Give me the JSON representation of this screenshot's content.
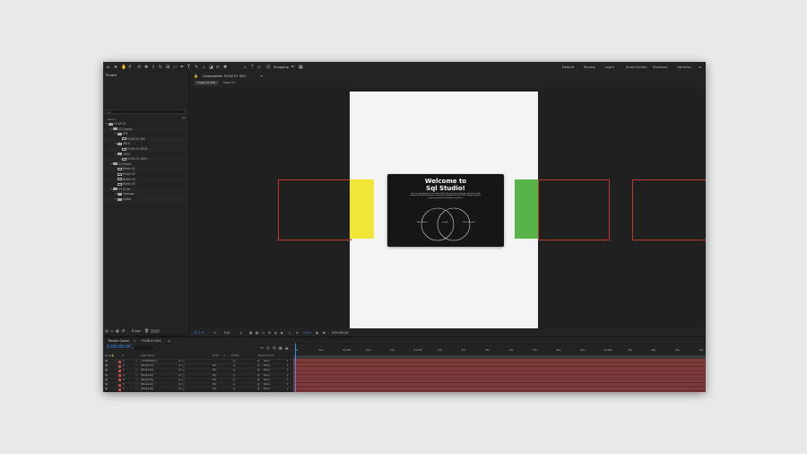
{
  "toolbar": {
    "snapping_label": "Snapping",
    "workspaces": [
      "Default",
      "Review",
      "Learn",
      "Small Screen",
      "Standard",
      "Libraries",
      "≫"
    ]
  },
  "project": {
    "tab_label": "Project",
    "search_placeholder": "ρ▾",
    "column_name": "Name",
    "tree": [
      {
        "label": "FLOW 01",
        "type": "folder",
        "indent": 0
      },
      {
        "label": "01.Comps",
        "type": "folder",
        "indent": 1
      },
      {
        "label": "495",
        "type": "folder",
        "indent": 2
      },
      {
        "label": "FLOW 01 495",
        "type": "comp",
        "indent": 3
      },
      {
        "label": "9816",
        "type": "folder",
        "indent": 2
      },
      {
        "label": "FLOW 01 9816",
        "type": "comp",
        "indent": 3
      },
      {
        "label": "1609",
        "type": "folder",
        "indent": 2
      },
      {
        "label": "FLOW 01 1609",
        "type": "comp",
        "indent": 3
      },
      {
        "label": "02.Media",
        "type": "folder",
        "indent": 1
      },
      {
        "label": "Media 01",
        "type": "comp",
        "indent": 2
      },
      {
        "label": "Media 02",
        "type": "comp",
        "indent": 2
      },
      {
        "label": "Media 03",
        "type": "comp",
        "indent": 2
      },
      {
        "label": "Media 04",
        "type": "comp",
        "indent": 2
      },
      {
        "label": "03.Other",
        "type": "folder",
        "indent": 1
      },
      {
        "label": "Footage",
        "type": "folder",
        "indent": 2
      },
      {
        "label": "Solids",
        "type": "folder",
        "indent": 2
      }
    ],
    "footer_bpc": "8 bpc"
  },
  "viewer": {
    "panel_tab": "Composition FLOW 01 9X5",
    "sub_tabs": [
      "FLOW 01 9X5",
      "Media 01"
    ],
    "card_title_line1": "Welcome to",
    "card_title_line2": "Sql Studio!",
    "card_body": "Our core specialization is the modern SQL structured query language and how it works alongside relational databases, from data modelling and optimisation through analytics, reporting and practical hands-on solutions.",
    "venn_left": "Web Master",
    "venn_center": "Insight",
    "venn_right": "Data Scientist",
    "colors": {
      "yellow": "#f2e737",
      "green": "#58b448",
      "card": "#161616",
      "artboard": "#f4f4f4",
      "outline": "#c0392b"
    },
    "footer": {
      "zoom": "12.5 %",
      "resolution": "Full",
      "exposure": "+0.0",
      "timecode": "0:00:00:00"
    }
  },
  "timeline": {
    "tabs": [
      "Render Queue",
      "FLOW 01 9X5"
    ],
    "timecode": "0:00:00:00",
    "search_placeholder": "ρ▾",
    "columns": [
      "#",
      "Layer Name",
      "Mode",
      "T",
      "TrkMat",
      "Parent & Link"
    ],
    "layers": [
      {
        "num": "1",
        "name": "[ CONTROLS ]",
        "mode": "",
        "trkmat": "",
        "parent": "None"
      },
      {
        "num": "2",
        "name": "[Media 01]",
        "mode": "Nor",
        "trkmat": "",
        "parent": "None"
      },
      {
        "num": "3",
        "name": "[Media 02]",
        "mode": "Nor",
        "trkmat": "",
        "parent": "None"
      },
      {
        "num": "4",
        "name": "[Media 03]",
        "mode": "Nor",
        "trkmat": "",
        "parent": "None"
      },
      {
        "num": "5",
        "name": "[Media 04]",
        "mode": "Nor",
        "trkmat": "",
        "parent": "None"
      },
      {
        "num": "6",
        "name": "[Media 05]",
        "mode": "Nor",
        "trkmat": "",
        "parent": "None"
      },
      {
        "num": "7",
        "name": "[Media 06]",
        "mode": "Nor",
        "trkmat": "",
        "parent": "None"
      }
    ],
    "ruler": [
      "0s",
      "02s",
      "01:00f",
      "05s",
      "10s",
      "01:00f",
      "15s",
      "20s",
      "25s",
      "30s",
      "35s",
      "40s",
      "45s",
      "01:00f",
      "55s",
      "60s",
      "65s",
      "70s",
      "75s"
    ]
  }
}
